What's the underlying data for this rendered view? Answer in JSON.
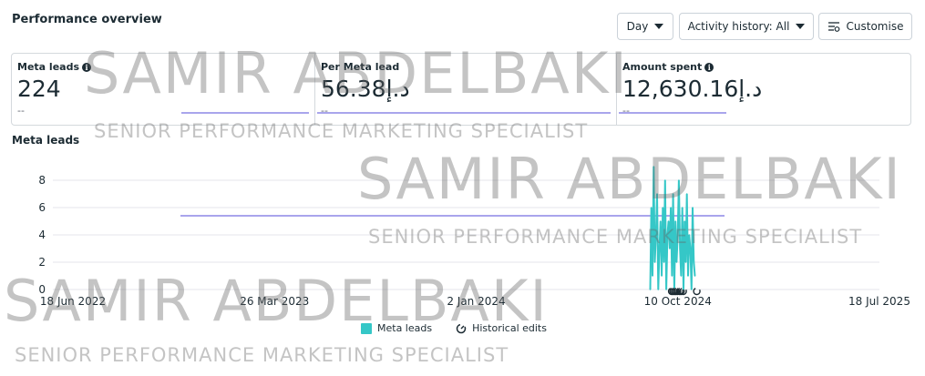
{
  "header": {
    "title": "Performance overview",
    "day_label": "Day",
    "activity_label": "Activity history: All",
    "customise_label": "Customise"
  },
  "metrics": [
    {
      "label": "Meta leads",
      "value": "224",
      "delta": "--",
      "info": true
    },
    {
      "label": "Per Meta lead",
      "value": "56.38د.إ",
      "delta": "--",
      "info": false
    },
    {
      "label": "Amount spent",
      "value": "12,630.16د.إ",
      "delta": "--",
      "info": true
    }
  ],
  "chart_section_title": "Meta leads",
  "legend": {
    "series_label": "Meta leads",
    "edits_label": "Historical edits"
  },
  "watermark": {
    "name": "SAMIR ABDELBAKI",
    "role": "SENIOR PERFORMANCE MARKETING SPECIALIST"
  },
  "colors": {
    "series": "#35c7c7",
    "reference_line": "#a9a5ec",
    "grid": "#e4e6eb"
  },
  "chart_data": {
    "type": "line",
    "title": "Meta leads",
    "ylim": [
      0,
      8
    ],
    "yticks": [
      0,
      2,
      4,
      6,
      8
    ],
    "x_tick_labels": [
      "18 Jun 2022",
      "26 Mar 2023",
      "2 Jan 2024",
      "10 Oct 2024",
      "18 Jul 2025"
    ],
    "x_range": [
      "2022-06-18",
      "2025-07-18"
    ],
    "grid": true,
    "legend": "bottom",
    "series": [
      {
        "name": "Meta leads",
        "start_date": "2024-09-01",
        "values": [
          0,
          6,
          1,
          9,
          2,
          4,
          7,
          0,
          3,
          5,
          1,
          6,
          2,
          8,
          0,
          4,
          5,
          3,
          6,
          1,
          7,
          0,
          5,
          2,
          4,
          8,
          3,
          1,
          6,
          0,
          5,
          2,
          7,
          1,
          4,
          3,
          0,
          6,
          2,
          1
        ]
      }
    ],
    "historical_edit_markers": [
      "2024-10-01",
      "2024-10-03",
      "2024-10-05",
      "2024-10-07",
      "2024-10-09",
      "2024-10-12",
      "2024-10-14",
      "2024-10-17",
      "2024-11-05"
    ]
  }
}
